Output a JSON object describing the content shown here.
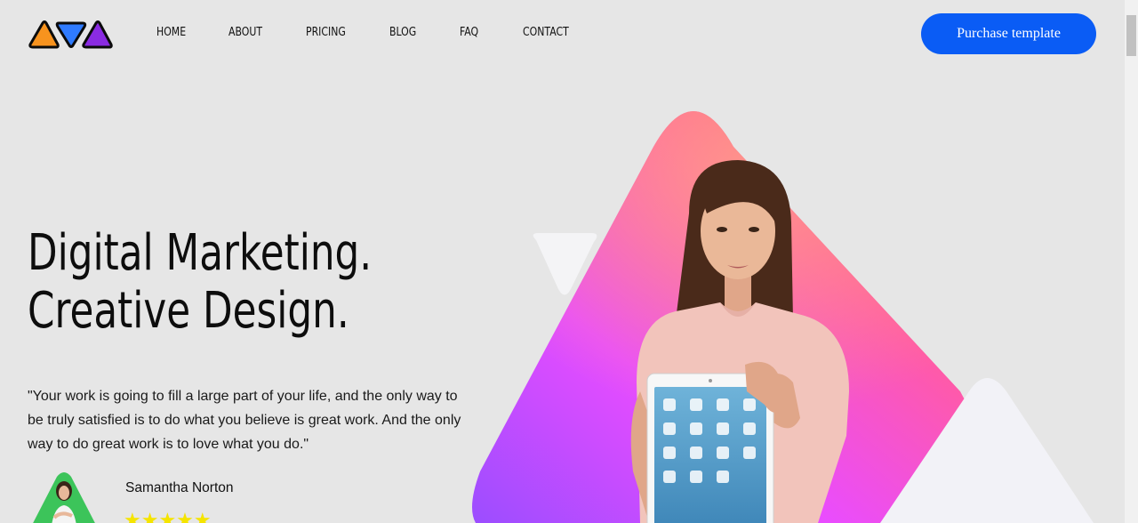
{
  "header": {
    "nav": [
      {
        "label": "HOME"
      },
      {
        "label": "ABOUT"
      },
      {
        "label": "PRICING"
      },
      {
        "label": "BLOG"
      },
      {
        "label": "FAQ"
      },
      {
        "label": "CONTACT"
      }
    ],
    "purchase_label": "Purchase template"
  },
  "hero": {
    "title_line1": "Digital Marketing.",
    "title_line2": "Creative Design.",
    "quote": "\"Your work is going to fill a large part of your life, and the only way to be truly satisfied is to do what you believe is great work. And the only way to do great work is to love what you do.\"",
    "author_name": "Samantha Norton",
    "rating": 5,
    "stars": "★★★★★"
  },
  "colors": {
    "accent": "#0a5cf5",
    "background": "#e6e6e6",
    "star": "#f5e400",
    "logo_orange": "#f7931e",
    "logo_blue": "#2f7bff",
    "logo_purple": "#8a2be2"
  },
  "icons": {
    "logo": "triangle-logo-icon",
    "star": "star-icon"
  }
}
